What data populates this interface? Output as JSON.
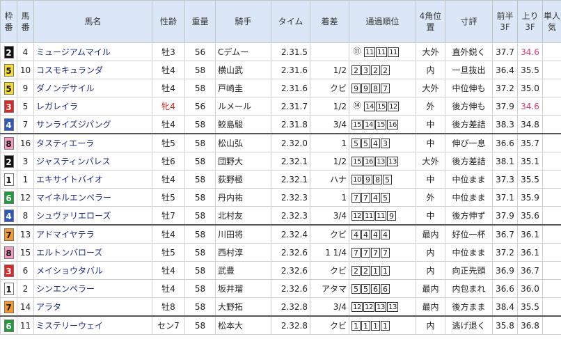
{
  "headers": {
    "waku": "枠番",
    "umaban": "馬番",
    "name": "馬名",
    "sexage": "性齢",
    "weight": "重量",
    "jockey": "騎手",
    "time": "タイム",
    "margin": "着差",
    "passing": "通過順位",
    "corner4": "4角位置",
    "comment": "寸評",
    "first3f": "前半3F",
    "last3f": "上り3F",
    "pop": "単人気"
  },
  "colors": {
    "waku1": "#ffffff",
    "waku2": "#111111",
    "waku3": "#e32424",
    "waku4": "#2e58c0",
    "waku5": "#f5dd2a",
    "waku6": "#1f9a3d",
    "waku7": "#f59a26",
    "waku8": "#f19cc0",
    "header_bg": "#dbe6f6",
    "name_text": "#1a2a86",
    "last3f_best": "#d43878",
    "mare_sex": "#d41f1f"
  },
  "rows": [
    {
      "waku": "2",
      "umaban": "4",
      "name": "ミュージアムマイル",
      "sexage": "牡3",
      "weight": "56",
      "jockey": "Cデムー",
      "time": "2.31.5",
      "margin": "",
      "p1": "⑪",
      "p2": "11",
      "p3": "11",
      "p4": "11",
      "corner4": "大外",
      "comment": "直外鋭く",
      "first3f": "37.7",
      "last3f": "34.6",
      "pop": ""
    },
    {
      "waku": "5",
      "umaban": "10",
      "name": "コスモキュランダ",
      "sexage": "牡4",
      "weight": "58",
      "jockey": "横山武",
      "time": "2.31.6",
      "margin": "1/2",
      "p1": "2",
      "p2": "3",
      "p3": "2",
      "p4": "2",
      "corner4": "内",
      "comment": "一旦抜出",
      "first3f": "36.4",
      "last3f": "35.5",
      "pop": ""
    },
    {
      "waku": "5",
      "umaban": "9",
      "name": "ダノンデサイル",
      "sexage": "牡4",
      "weight": "58",
      "jockey": "戸崎圭",
      "time": "2.31.6",
      "margin": "クビ",
      "p1": "9",
      "p2": "9",
      "p3": "8",
      "p4": "7",
      "corner4": "大外",
      "comment": "中位伸も",
      "first3f": "37.2",
      "last3f": "35.0",
      "pop": ""
    },
    {
      "waku": "3",
      "umaban": "5",
      "name": "レガレイラ",
      "sexage": "牝4",
      "weight": "56",
      "jockey": "ルメール",
      "time": "2.31.7",
      "margin": "1/2",
      "p1": "⑭",
      "p2": "14",
      "p3": "15",
      "p4": "12",
      "corner4": "外",
      "comment": "後方伸も",
      "first3f": "37.9",
      "last3f": "34.6",
      "pop": ""
    },
    {
      "waku": "4",
      "umaban": "7",
      "name": "サンライズジパング",
      "sexage": "牡4",
      "weight": "58",
      "jockey": "鮫島駿",
      "time": "2.31.8",
      "margin": "3/4",
      "p1": "15",
      "p2": "14",
      "p3": "15",
      "p4": "16",
      "corner4": "中",
      "comment": "後方差詰",
      "first3f": "38.3",
      "last3f": "34.8",
      "pop": ""
    },
    {
      "waku": "8",
      "umaban": "16",
      "name": "タスティエーラ",
      "sexage": "牡5",
      "weight": "58",
      "jockey": "松山弘",
      "time": "2.32.0",
      "margin": "1",
      "p1": "5",
      "p2": "5",
      "p3": "4",
      "p4": "3",
      "corner4": "中",
      "comment": "伸び一息",
      "first3f": "36.6",
      "last3f": "35.7",
      "pop": ""
    },
    {
      "waku": "2",
      "umaban": "3",
      "name": "ジャスティンパレス",
      "sexage": "牡6",
      "weight": "58",
      "jockey": "団野大",
      "time": "2.32.1",
      "margin": "1/2",
      "p1": "15",
      "p2": "16",
      "p3": "13",
      "p4": "13",
      "corner4": "大外",
      "comment": "後方差詰",
      "first3f": "38.1",
      "last3f": "35.1",
      "pop": ""
    },
    {
      "waku": "1",
      "umaban": "1",
      "name": "エキサイトバイオ",
      "sexage": "牡4",
      "weight": "58",
      "jockey": "荻野極",
      "time": "2.32.1",
      "margin": "ハナ",
      "p1": "10",
      "p2": "9",
      "p3": "8",
      "p4": "5",
      "corner4": "中",
      "comment": "中位まま",
      "first3f": "37.3",
      "last3f": "35.5",
      "pop": ""
    },
    {
      "waku": "6",
      "umaban": "12",
      "name": "マイネルエンペラー",
      "sexage": "牡5",
      "weight": "58",
      "jockey": "丹内祐",
      "time": "2.32.3",
      "margin": "1",
      "p1": "7",
      "p2": "7",
      "p3": "4",
      "p4": "5",
      "corner4": "外",
      "comment": "中位まま",
      "first3f": "37.1",
      "last3f": "35.9",
      "pop": ""
    },
    {
      "waku": "4",
      "umaban": "8",
      "name": "シュヴァリエローズ",
      "sexage": "牡7",
      "weight": "58",
      "jockey": "北村友",
      "time": "2.32.3",
      "margin": "3/4",
      "p1": "12",
      "p2": "11",
      "p3": "11",
      "p4": "9",
      "corner4": "中",
      "comment": "後方伸ず",
      "first3f": "37.9",
      "last3f": "35.6",
      "pop": ""
    },
    {
      "waku": "7",
      "umaban": "13",
      "name": "アドマイヤテラ",
      "sexage": "牡4",
      "weight": "58",
      "jockey": "川田将",
      "time": "2.32.4",
      "margin": "クビ",
      "p1": "4",
      "p2": "4",
      "p3": "4",
      "p4": "4",
      "corner4": "最内",
      "comment": "好位一杯",
      "first3f": "36.7",
      "last3f": "36.1",
      "pop": ""
    },
    {
      "waku": "8",
      "umaban": "15",
      "name": "エルトンバローズ",
      "sexage": "牡5",
      "weight": "58",
      "jockey": "西村淳",
      "time": "2.32.6",
      "margin": "1 1/4",
      "p1": "7",
      "p2": "7",
      "p3": "7",
      "p4": "7",
      "corner4": "内",
      "comment": "中位まま",
      "first3f": "37.2",
      "last3f": "36.1",
      "pop": ""
    },
    {
      "waku": "3",
      "umaban": "6",
      "name": "メイショウタバル",
      "sexage": "牡4",
      "weight": "58",
      "jockey": "武豊",
      "time": "2.32.6",
      "margin": "クビ",
      "p1": "2",
      "p2": "2",
      "p3": "1",
      "p4": "1",
      "corner4": "内",
      "comment": "向正先頭",
      "first3f": "36.9",
      "last3f": "36.7",
      "pop": ""
    },
    {
      "waku": "1",
      "umaban": "2",
      "name": "シンエンペラー",
      "sexage": "牡4",
      "weight": "58",
      "jockey": "坂井瑠",
      "time": "2.32.6",
      "margin": "アタマ",
      "p1": "5",
      "p2": "5",
      "p3": "6",
      "p4": "6",
      "corner4": "最内",
      "comment": "内包まれ",
      "first3f": "36.6",
      "last3f": "36.0",
      "pop": ""
    },
    {
      "waku": "7",
      "umaban": "14",
      "name": "アラタ",
      "sexage": "牡8",
      "weight": "58",
      "jockey": "大野拓",
      "time": "2.32.8",
      "margin": "3/4",
      "p1": "12",
      "p2": "12",
      "p3": "13",
      "p4": "13",
      "corner4": "最内",
      "comment": "後方まま",
      "first3f": "38.4",
      "last3f": "35.5",
      "pop": ""
    },
    {
      "waku": "6",
      "umaban": "11",
      "name": "ミステリーウェイ",
      "sexage": "セン7",
      "weight": "58",
      "jockey": "松本大",
      "time": "2.32.8",
      "margin": "クビ",
      "p1": "1",
      "p2": "1",
      "p3": "1",
      "p4": "1",
      "corner4": "内",
      "comment": "逃げ退く",
      "first3f": "35.8",
      "last3f": "36.8",
      "pop": ""
    }
  ]
}
